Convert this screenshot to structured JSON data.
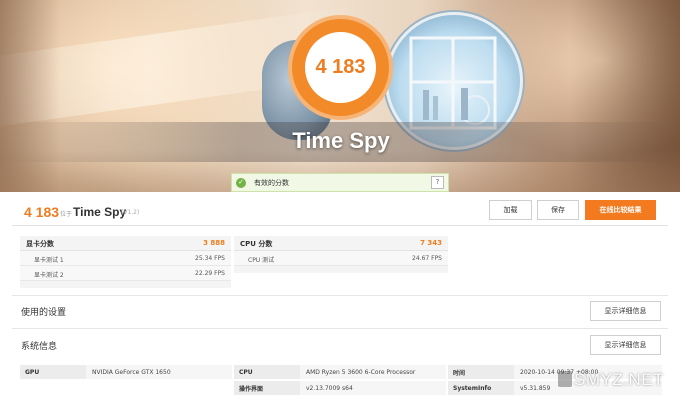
{
  "hero": {
    "score": "4 183",
    "title": "Time Spy"
  },
  "valid_bar": {
    "text": "有效的分数",
    "help": "?"
  },
  "result": {
    "score": "4 183",
    "unit": "位于",
    "benchmark": "Time Spy",
    "version": "(V1.2)",
    "buttons": {
      "load": "加载",
      "save": "保存",
      "compare_online": "在线比较结果"
    }
  },
  "gpu_score": {
    "label": "显卡分数",
    "value": "3 888",
    "rows": [
      {
        "label": "显卡测试 1",
        "value": "25.34 FPS"
      },
      {
        "label": "显卡测试 2",
        "value": "22.29 FPS"
      }
    ]
  },
  "cpu_score": {
    "label": "CPU 分数",
    "value": "7 343",
    "rows": [
      {
        "label": "CPU 测试",
        "value": "24.67 FPS"
      }
    ]
  },
  "settings": {
    "title": "使用的设置",
    "detail_button": "显示详细信息"
  },
  "sysinfo": {
    "title": "系统信息",
    "detail_button": "显示详细信息",
    "gpu_key": "GPU",
    "gpu_value": "NVIDIA GeForce GTX 1650",
    "cpu_key": "CPU",
    "cpu_value": "AMD Ryzen 5 3600 6-Core Processor",
    "gui_key": "操作界面",
    "gui_value": "v2.13.7009 s64",
    "time_key": "时间",
    "time_value": "2020-10-14 09:37 +08:00",
    "si_key": "SystemInfo",
    "si_value": "v5.31.859"
  },
  "watermark": "SMYZ.NET",
  "colors": {
    "accent": "#f47a20",
    "score": "#ef7d1f",
    "valid_green": "#73b343"
  }
}
